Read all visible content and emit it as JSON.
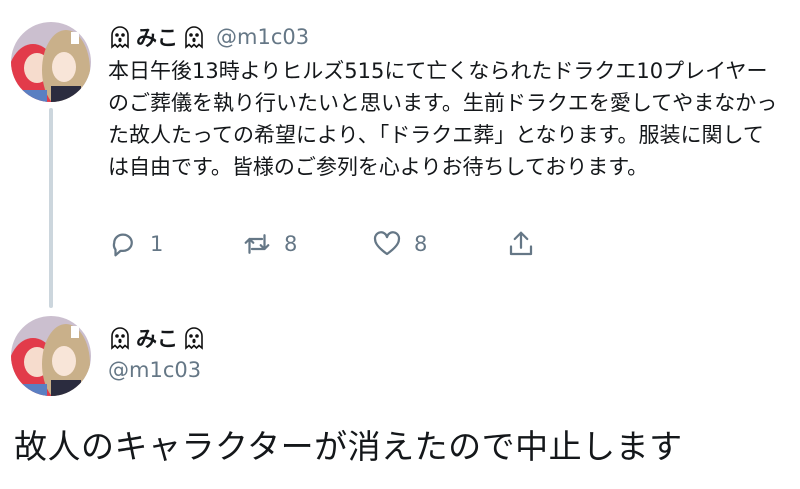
{
  "tweet": {
    "display_name": "みこ",
    "handle": "@m1c03",
    "text": "本日午後13時よりヒルズ515にて亡くなられたドラクエ10プレイヤーのご葬儀を執り行いたいと思います。生前ドラクエを愛してやまなかった故人たっての希望により、「ドラクエ葬」となります。服装に関しては自由です。皆様のご参列を心よりお待ちしております。",
    "actions": {
      "reply_icon": "reply-icon",
      "reply_count": "1",
      "retweet_icon": "retweet-icon",
      "retweet_count": "8",
      "like_icon": "heart-icon",
      "like_count": "8",
      "share_icon": "share-icon"
    }
  },
  "reply": {
    "display_name": "みこ",
    "handle": "@m1c03",
    "text": "故人のキャラクターが消えたので中止します"
  },
  "colors": {
    "text": "#14171a",
    "secondary": "#657786",
    "thread_line": "#ccd6dd"
  }
}
